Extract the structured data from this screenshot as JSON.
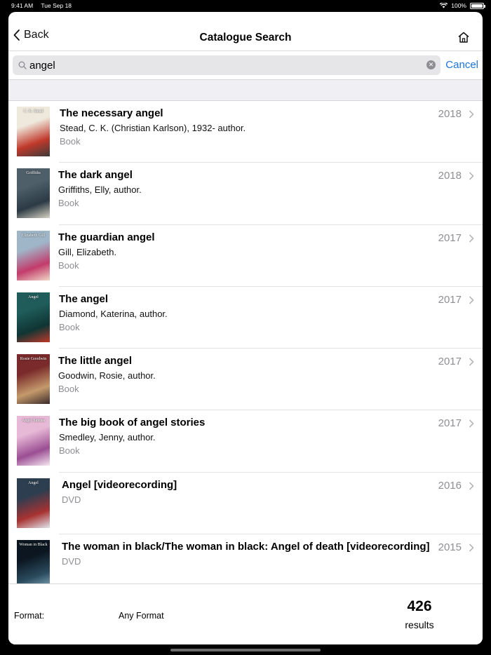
{
  "status_bar": {
    "time": "9:41 AM",
    "date": "Tue Sep 18",
    "battery": "100%"
  },
  "nav": {
    "back_label": "Back",
    "title": "Catalogue Search",
    "home_icon": "home-icon"
  },
  "search": {
    "value": "angel",
    "cancel_label": "Cancel"
  },
  "results": [
    {
      "title": "The necessary angel",
      "author": "Stead, C. K. (Christian Karlson), 1932- author.",
      "format": "Book",
      "year": "2018"
    },
    {
      "title": "The dark angel",
      "author": "Griffiths, Elly, author.",
      "format": "Book",
      "year": "2018"
    },
    {
      "title": "The guardian angel",
      "author": "Gill, Elizabeth.",
      "format": "Book",
      "year": "2017"
    },
    {
      "title": "The angel",
      "author": "Diamond, Katerina, author.",
      "format": "Book",
      "year": "2017"
    },
    {
      "title": "The little angel",
      "author": "Goodwin, Rosie, author.",
      "format": "Book",
      "year": "2017"
    },
    {
      "title": "The big book of angel stories",
      "author": "Smedley, Jenny, author.",
      "format": "Book",
      "year": "2017"
    },
    {
      "title": "Angel [videorecording]",
      "author": "",
      "format": "DVD",
      "year": "2016"
    },
    {
      "title": "The woman in black/The woman in black: Angel of death [videorecording]",
      "author": "",
      "format": "DVD",
      "year": "2015"
    }
  ],
  "covers": [
    {
      "label": "C. K. Stead",
      "colors": [
        "#efe9dd",
        "#c0392b",
        "#3a3a3a"
      ]
    },
    {
      "label": "Griffiths",
      "colors": [
        "#4e5f6a",
        "#2b3a44",
        "#d8d2c4"
      ]
    },
    {
      "label": "Elizabeth Gill",
      "colors": [
        "#9fb6c9",
        "#c23b6b",
        "#f0d9c8"
      ]
    },
    {
      "label": "Angel",
      "colors": [
        "#1f5c5a",
        "#0f3533",
        "#c0392b"
      ]
    },
    {
      "label": "Rosie Goodwin",
      "colors": [
        "#7a2a2a",
        "#c49a6c",
        "#3b2a2a"
      ]
    },
    {
      "label": "Angel Stories",
      "colors": [
        "#e7b9d6",
        "#9b4e93",
        "#f6e8f2"
      ]
    },
    {
      "label": "Angel",
      "colors": [
        "#2c3e50",
        "#a83232",
        "#dfe6ec"
      ]
    },
    {
      "label": "Woman in Black",
      "colors": [
        "#0b1620",
        "#2a4b5e",
        "#8fb3c4"
      ]
    }
  ],
  "footer": {
    "format_label": "Format:",
    "format_value": "Any Format",
    "count": "426",
    "results_label": "results"
  },
  "colors": {
    "accent": "#1a73d9",
    "secondary_text": "#8e8e93",
    "section_bg": "#efeff4"
  }
}
